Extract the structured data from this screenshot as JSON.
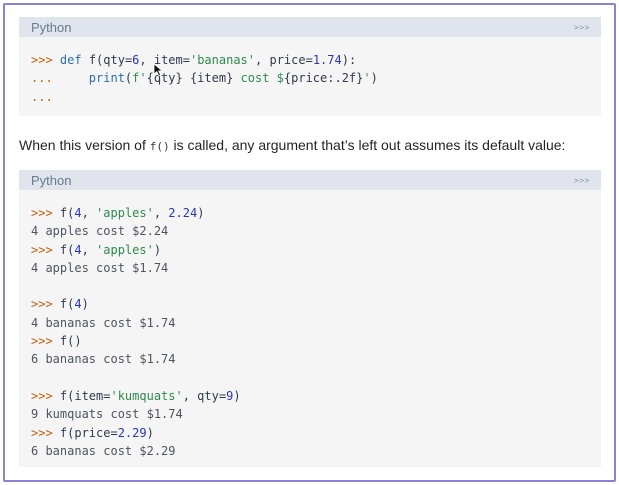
{
  "block1": {
    "language": "Python",
    "prompt_toggle": ">>>",
    "lines": [
      [
        {
          "t": ">>> ",
          "c": "prompt"
        },
        {
          "t": "def",
          "c": "kw"
        },
        {
          "t": " f(qty=",
          "c": ""
        },
        {
          "t": "6",
          "c": "num"
        },
        {
          "t": ", item=",
          "c": ""
        },
        {
          "t": "'bananas'",
          "c": "str"
        },
        {
          "t": ", price=",
          "c": ""
        },
        {
          "t": "1.74",
          "c": "num"
        },
        {
          "t": "):",
          "c": ""
        }
      ],
      [
        {
          "t": "...     ",
          "c": "prompt"
        },
        {
          "t": "print",
          "c": "kw"
        },
        {
          "t": "(",
          "c": ""
        },
        {
          "t": "f'",
          "c": "str"
        },
        {
          "t": "{qty} {item}",
          "c": ""
        },
        {
          "t": " cost $",
          "c": "str"
        },
        {
          "t": "{price:.2f}",
          "c": ""
        },
        {
          "t": "'",
          "c": "str"
        },
        {
          "t": ")",
          "c": ""
        }
      ],
      [
        {
          "t": "...",
          "c": "prompt"
        }
      ]
    ]
  },
  "prose": {
    "before": "When this version of ",
    "code": "f()",
    "after": " is called, any argument that’s left out assumes its default value:"
  },
  "block2": {
    "language": "Python",
    "prompt_toggle": ">>>",
    "lines": [
      [
        {
          "t": ">>> ",
          "c": "prompt"
        },
        {
          "t": "f(",
          "c": ""
        },
        {
          "t": "4",
          "c": "num"
        },
        {
          "t": ", ",
          "c": ""
        },
        {
          "t": "'apples'",
          "c": "str"
        },
        {
          "t": ", ",
          "c": ""
        },
        {
          "t": "2.24",
          "c": "num"
        },
        {
          "t": ")",
          "c": ""
        }
      ],
      [
        {
          "t": "4 apples cost $2.24",
          "c": "out"
        }
      ],
      [
        {
          "t": ">>> ",
          "c": "prompt"
        },
        {
          "t": "f(",
          "c": ""
        },
        {
          "t": "4",
          "c": "num"
        },
        {
          "t": ", ",
          "c": ""
        },
        {
          "t": "'apples'",
          "c": "str"
        },
        {
          "t": ")",
          "c": ""
        }
      ],
      [
        {
          "t": "4 apples cost $1.74",
          "c": "out"
        }
      ],
      [],
      [
        {
          "t": ">>> ",
          "c": "prompt"
        },
        {
          "t": "f(",
          "c": ""
        },
        {
          "t": "4",
          "c": "num"
        },
        {
          "t": ")",
          "c": ""
        }
      ],
      [
        {
          "t": "4 bananas cost $1.74",
          "c": "out"
        }
      ],
      [
        {
          "t": ">>> ",
          "c": "prompt"
        },
        {
          "t": "f()",
          "c": ""
        }
      ],
      [
        {
          "t": "6 bananas cost $1.74",
          "c": "out"
        }
      ],
      [],
      [
        {
          "t": ">>> ",
          "c": "prompt"
        },
        {
          "t": "f(item=",
          "c": ""
        },
        {
          "t": "'kumquats'",
          "c": "str"
        },
        {
          "t": ", qty=",
          "c": ""
        },
        {
          "t": "9",
          "c": "num"
        },
        {
          "t": ")",
          "c": ""
        }
      ],
      [
        {
          "t": "9 kumquats cost $1.74",
          "c": "out"
        }
      ],
      [
        {
          "t": ">>> ",
          "c": "prompt"
        },
        {
          "t": "f(price=",
          "c": ""
        },
        {
          "t": "2.29",
          "c": "num"
        },
        {
          "t": ")",
          "c": ""
        }
      ],
      [
        {
          "t": "6 bananas cost $2.29",
          "c": "out"
        }
      ]
    ]
  },
  "colors": {
    "frame_border": "#8f7fd3",
    "block_background": "#f5f5f6",
    "header_background": "#dfe4ed",
    "prompt": "#c65d09",
    "keyword": "#2b6fb0",
    "number": "#2835b8",
    "string": "#2f8a4f"
  },
  "icons": {
    "cursor": "mouse-pointer-icon"
  }
}
